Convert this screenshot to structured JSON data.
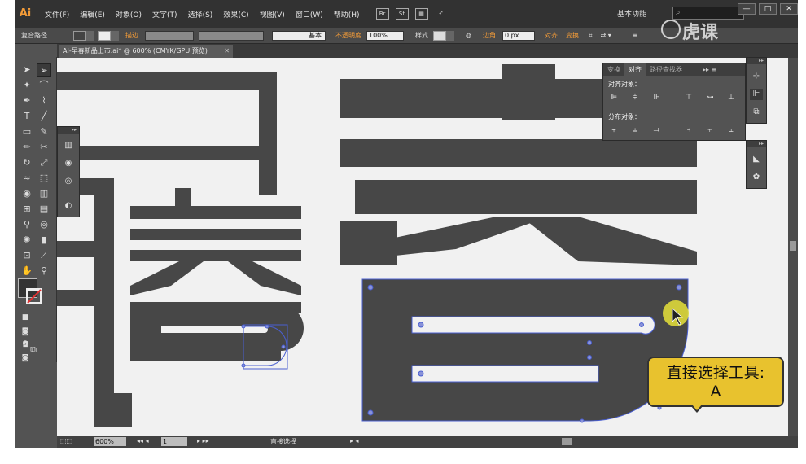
{
  "app": {
    "logo": "Ai"
  },
  "menu": {
    "items": [
      "文件(F)",
      "编辑(E)",
      "对象(O)",
      "文字(T)",
      "选择(S)",
      "效果(C)",
      "视图(V)",
      "窗口(W)",
      "帮助(H)"
    ],
    "icons": [
      "Br",
      "St"
    ],
    "workspace": "基本功能",
    "window_buttons": [
      "—",
      "□",
      "✕"
    ]
  },
  "control": {
    "selection_type": "复合路径",
    "stroke_label": "描边",
    "stroke_style": "基本",
    "opacity_label": "不透明度",
    "opacity_value": "100%",
    "style_label": "样式",
    "corner_label": "边角",
    "corner_value": "0 px",
    "align_label": "对齐",
    "transform_label": "变换"
  },
  "document": {
    "tab_title": "AI-早春新品上市.ai* @ 600% (CMYK/GPU 预览)",
    "close": "✕"
  },
  "align_panel": {
    "tabs": [
      "变换",
      "对齐",
      "路径查找器"
    ],
    "active_tab": "对齐",
    "align_objects_label": "对齐对象：",
    "distribute_objects_label": "分布对象："
  },
  "status": {
    "zoom": "600%",
    "page": "1",
    "tool_name": "直接选择"
  },
  "tooltip": {
    "line1": "直接选择工具:",
    "line2": "A"
  },
  "watermark": {
    "text": "虎课"
  },
  "colors": {
    "glyph": "#474747",
    "selection": "#4a5fd1",
    "tooltip": "#e8c22e",
    "cursor_highlight": "#e6e23a",
    "accent": "#f29b38"
  }
}
